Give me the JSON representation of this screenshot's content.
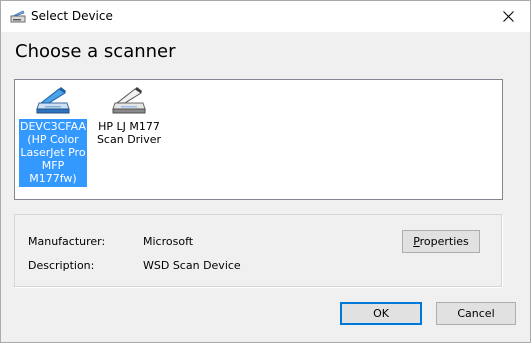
{
  "window": {
    "title": "Select Device"
  },
  "heading": "Choose a scanner",
  "devices": [
    {
      "label": "DEVC3CFAA (HP Color LaserJet Pro MFP M177fw)",
      "icon": "scanner-icon",
      "selected": true
    },
    {
      "label": "HP LJ M177 Scan Driver",
      "icon": "scanner-icon",
      "selected": false
    }
  ],
  "info": {
    "manufacturer_label": "Manufacturer:",
    "manufacturer_value": "Microsoft",
    "description_label": "Description:",
    "description_value": "WSD Scan Device",
    "properties_button_accel": "P",
    "properties_button_rest": "roperties"
  },
  "buttons": {
    "ok": "OK",
    "cancel": "Cancel"
  },
  "colors": {
    "selection": "#3399ff",
    "default_button_border": "#0078d7",
    "dialog_background": "#f0f0f0"
  }
}
